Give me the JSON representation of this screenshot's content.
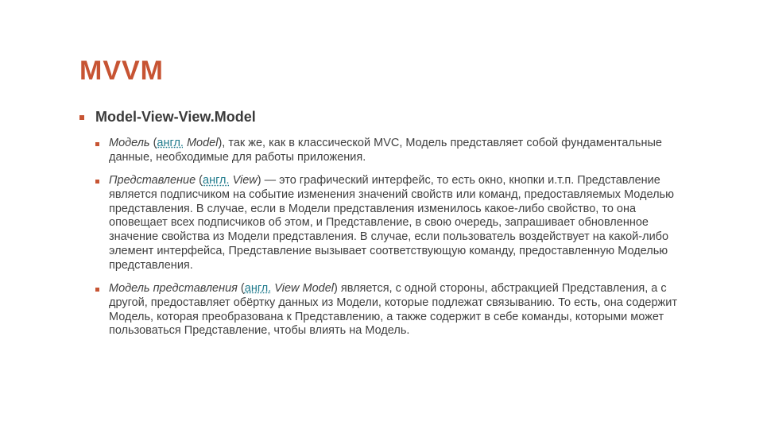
{
  "slide": {
    "title": "MVVM",
    "subtitle": "Model-View-View.Model",
    "items": [
      {
        "lead_italic": "Модель",
        "open": " (",
        "link": "англ.",
        "after_link_italic": " Model",
        "rest": "), так же, как в классической MVC, Модель представляет собой фундаментальные данные, необходимые для работы приложения."
      },
      {
        "lead_italic": "Представление",
        "open": " (",
        "link": "англ.",
        "after_link_italic": " View",
        "rest": ") — это графический интерфейс, то есть окно, кнопки и.т.п. Представление является подписчиком на событие изменения значений свойств или команд, предоставляемых Моделью представления. В случае, если в Модели представления изменилось какое-либо свойство, то она оповещает всех подписчиков об этом, и Представление, в свою очередь, запрашивает обновленное значение свойства из Модели представления. В случае, если пользователь воздействует на какой-либо элемент интерфейса, Представление вызывает соответствующую команду, предоставленную Моделью представления."
      },
      {
        "lead_italic": "Модель представления",
        "open": " (",
        "link": "англ.",
        "after_link_italic": " View Model",
        "rest": ") является, с одной стороны, абстракцией Представления, а с другой, предоставляет обёртку данных из Модели, которые подлежат связыванию. То есть, она содержит Модель, которая преобразована к Представлению, а также содержит в себе команды, которыми может пользоваться Представление, чтобы влиять на Модель."
      }
    ]
  }
}
